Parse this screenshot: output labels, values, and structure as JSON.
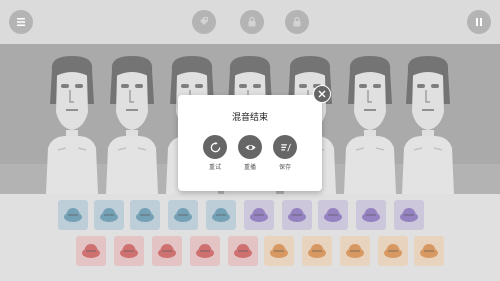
{
  "dialog": {
    "title": "混音结束",
    "buttons": [
      {
        "label": "重试",
        "icon": "restart-icon"
      },
      {
        "label": "重播",
        "icon": "eye-icon"
      },
      {
        "label": "保存",
        "icon": "save-icon"
      }
    ]
  },
  "topbar": {
    "menu_icon": "menu-icon",
    "center_icons": [
      "tag-icon",
      "lock-icon",
      "lock-icon"
    ],
    "pause_icon": "pause-icon"
  },
  "colors": {
    "tray_background": "#cfcfcf",
    "stage_background": "#7d7d7d",
    "dialog_button": "#666666",
    "blue_tile": "#9bb4c4",
    "purple_tile": "#b3a9c8",
    "red_tile": "#d4a4a4",
    "orange_tile": "#dcbc9c"
  },
  "sound_icons_row1": [
    {
      "name": "cap-icon",
      "color": "blue"
    },
    {
      "name": "hat-icon",
      "color": "blue"
    },
    {
      "name": "mask-icon",
      "color": "blue"
    },
    {
      "name": "hand-icon",
      "color": "blue"
    },
    {
      "name": "helmet-icon",
      "color": "blue"
    },
    {
      "name": "headphones-icon",
      "color": "purple"
    },
    {
      "name": "helmet-icon",
      "color": "purple"
    },
    {
      "name": "wings-icon",
      "color": "purple"
    },
    {
      "name": "crown-icon",
      "color": "purple"
    },
    {
      "name": "visor-icon",
      "color": "purple"
    }
  ],
  "sound_icons_row2": [
    {
      "name": "bow-icon",
      "color": "red"
    },
    {
      "name": "hat-icon",
      "color": "red"
    },
    {
      "name": "mask-icon",
      "color": "red"
    },
    {
      "name": "beret-icon",
      "color": "red"
    },
    {
      "name": "skull-icon",
      "color": "red"
    },
    {
      "name": "cap-icon",
      "color": "orange"
    },
    {
      "name": "glasses-icon",
      "color": "orange"
    },
    {
      "name": "drum-icon",
      "color": "orange"
    },
    {
      "name": "cat-ears-icon",
      "color": "orange"
    },
    {
      "name": "sunglasses-icon",
      "color": "orange"
    }
  ]
}
